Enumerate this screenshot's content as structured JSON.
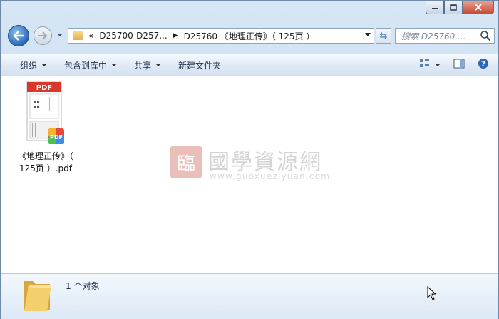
{
  "address": {
    "segments": [
      "D25700-D257...",
      "D25760 《地理正传》（ 125页 ）"
    ]
  },
  "search": {
    "placeholder": "搜索 D25760 ..."
  },
  "toolbar": {
    "organize": "组织",
    "include_library": "包含到库中",
    "share": "共享",
    "new_folder": "新建文件夹"
  },
  "files": [
    {
      "name_line1": "《地理正传》（",
      "name_line2": "125页 ）.pdf",
      "thumbnail_label": "PDF",
      "icon": "pdf-file-icon"
    }
  ],
  "watermark": {
    "seal_char": "臨",
    "title": "國學資源網",
    "url": "www.guoxueziyuan.com"
  },
  "status": {
    "item_count": "1 个对象"
  },
  "colors": {
    "accent": "#2a6ab5",
    "pdf_red": "#d9372b",
    "folder": "#e8b84f"
  }
}
